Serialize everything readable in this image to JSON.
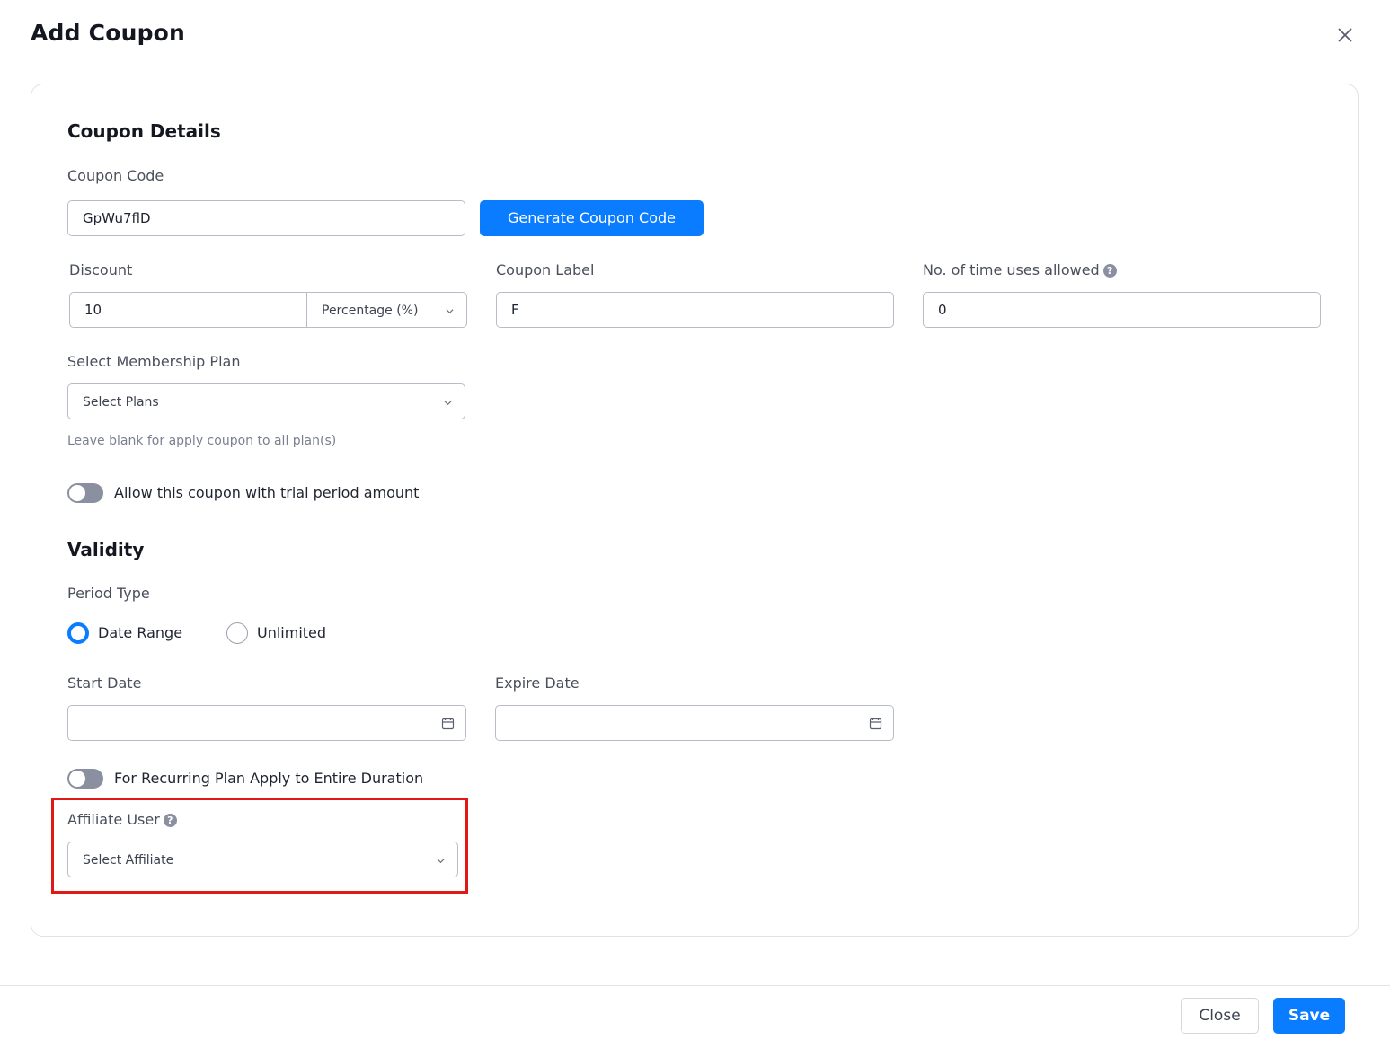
{
  "modal": {
    "title": "Add Coupon",
    "close_icon": "close-icon"
  },
  "coupon_details": {
    "section_title": "Coupon Details",
    "coupon_code_label": "Coupon Code",
    "coupon_code_value": "GpWu7flD",
    "generate_button": "Generate Coupon Code",
    "discount_label": "Discount",
    "discount_value": "10",
    "discount_type": "Percentage (%)",
    "coupon_label_label": "Coupon Label",
    "coupon_label_value": "F",
    "uses_label": "No. of time uses allowed",
    "uses_value": "0",
    "membership_plan_label": "Select Membership Plan",
    "membership_plan_placeholder": "Select Plans",
    "membership_plan_hint": "Leave blank for apply coupon to all plan(s)",
    "trial_toggle_label": "Allow this coupon with trial period amount",
    "trial_toggle_on": false
  },
  "validity": {
    "section_title": "Validity",
    "period_type_label": "Period Type",
    "period_options": [
      "Date Range",
      "Unlimited"
    ],
    "period_selected": "Date Range",
    "start_date_label": "Start Date",
    "start_date_value": "",
    "expire_date_label": "Expire Date",
    "expire_date_value": "",
    "recurring_toggle_label": "For Recurring Plan Apply to Entire Duration",
    "recurring_toggle_on": false,
    "affiliate_label": "Affiliate User",
    "affiliate_placeholder": "Select Affiliate"
  },
  "footer": {
    "close_button": "Close",
    "save_button": "Save"
  },
  "colors": {
    "primary": "#0a7cff",
    "highlight": "#e01818",
    "toggle_off": "#8a90a0"
  }
}
